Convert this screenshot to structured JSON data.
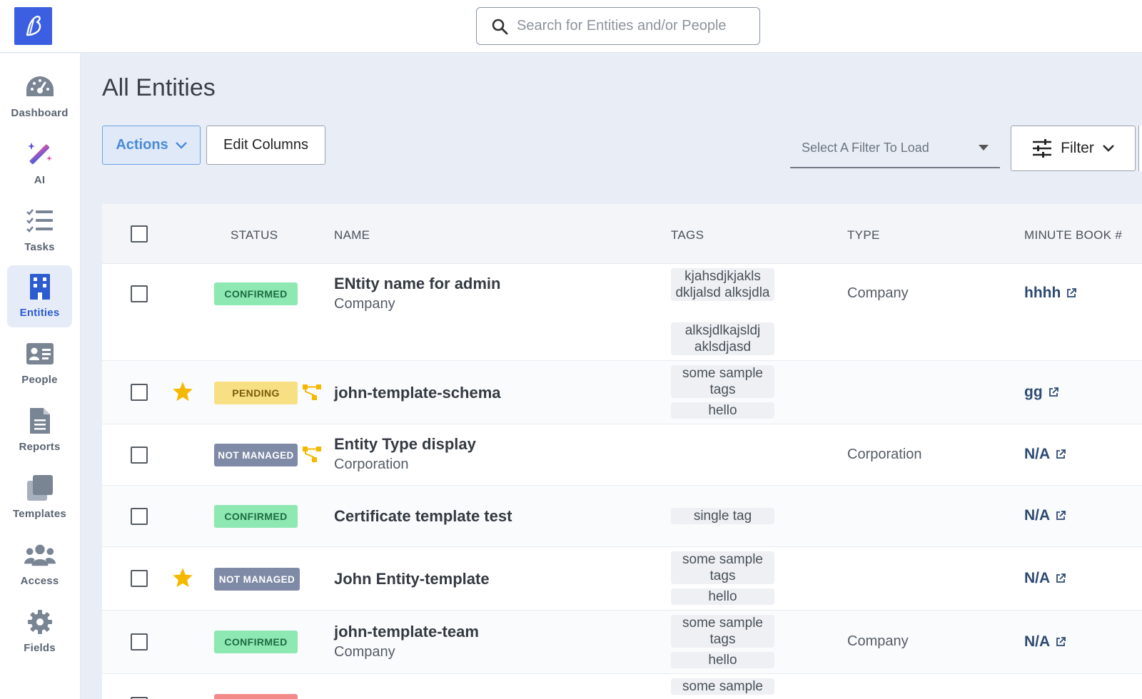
{
  "search": {
    "placeholder": "Search for Entities and/or People"
  },
  "sidebar": {
    "items": [
      {
        "label": "Dashboard",
        "icon": "dashboard-icon"
      },
      {
        "label": "AI",
        "icon": "magic-wand-icon"
      },
      {
        "label": "Tasks",
        "icon": "tasks-icon"
      },
      {
        "label": "Entities",
        "icon": "building-icon",
        "active": true
      },
      {
        "label": "People",
        "icon": "id-card-icon"
      },
      {
        "label": "Reports",
        "icon": "document-icon"
      },
      {
        "label": "Templates",
        "icon": "templates-icon"
      },
      {
        "label": "Access",
        "icon": "users-icon"
      },
      {
        "label": "Fields",
        "icon": "gear-icon"
      }
    ]
  },
  "page": {
    "title": "All Entities"
  },
  "toolbar": {
    "actions_label": "Actions",
    "edit_columns_label": "Edit Columns",
    "filter_select_placeholder": "Select A Filter To Load",
    "filter_label": "Filter"
  },
  "table": {
    "columns": [
      "STATUS",
      "NAME",
      "TAGS",
      "TYPE",
      "MINUTE BOOK #"
    ],
    "rows": [
      {
        "status": "CONFIRMED",
        "name": "ENtity name for admin",
        "sub": "Company",
        "tags": [
          "kjahsdjkjakls dkljalsd alksjdla",
          "alksjdlkajsldj aklsdjasd"
        ],
        "type": "Company",
        "minute_book": "hhhh",
        "starred": false,
        "tree": false
      },
      {
        "status": "PENDING",
        "name": "john-template-schema",
        "sub": "",
        "tags": [
          "some sample tags",
          "hello"
        ],
        "type": "",
        "minute_book": "gg",
        "starred": true,
        "tree": true
      },
      {
        "status": "NOT MANAGED",
        "name": "Entity Type display",
        "sub": "Corporation",
        "tags": [],
        "type": "Corporation",
        "minute_book": "N/A",
        "starred": false,
        "tree": true
      },
      {
        "status": "CONFIRMED",
        "name": "Certificate template test",
        "sub": "",
        "tags": [
          "single tag"
        ],
        "type": "",
        "minute_book": "N/A",
        "starred": false,
        "tree": false
      },
      {
        "status": "NOT MANAGED",
        "name": "John Entity-template",
        "sub": "",
        "tags": [
          "some sample tags",
          "hello"
        ],
        "type": "",
        "minute_book": "N/A",
        "starred": true,
        "tree": false
      },
      {
        "status": "CONFIRMED",
        "name": "john-template-team",
        "sub": "Company",
        "tags": [
          "some sample tags",
          "hello"
        ],
        "type": "Company",
        "minute_book": "N/A",
        "starred": false,
        "tree": false
      },
      {
        "status": "",
        "name": "",
        "sub": "",
        "tags": [
          "some sample"
        ],
        "type": "",
        "minute_book": "",
        "starred": false,
        "tree": false
      }
    ]
  },
  "colors": {
    "brand": "#3b5fe0",
    "active_nav": "#2d5bd0",
    "confirmed": "#8ee8b2",
    "pending": "#f7df84",
    "not_managed": "#7e8aa6",
    "star": "#f5b800",
    "link": "#2d4a73"
  }
}
